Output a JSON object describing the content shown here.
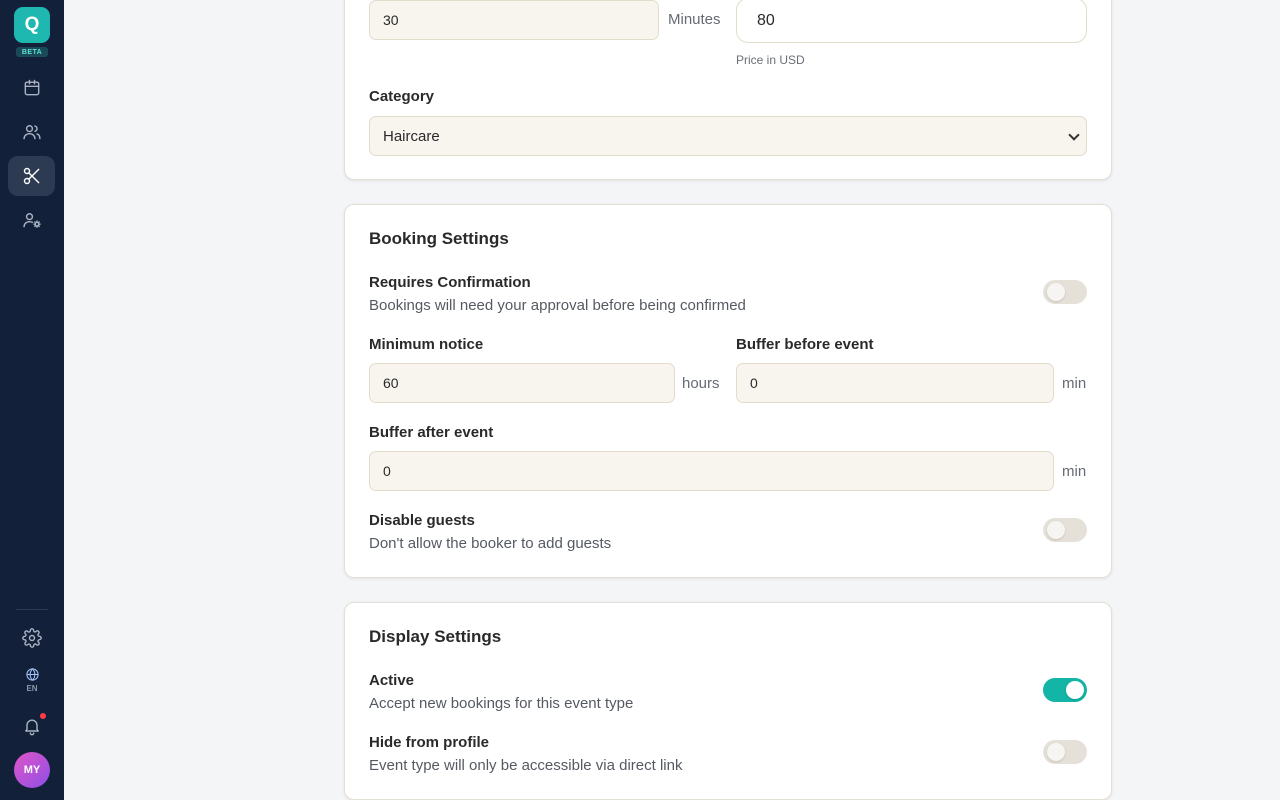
{
  "sidebar": {
    "logo_letter": "Q",
    "beta_label": "BETA",
    "nav": [
      {
        "icon": "calendar-icon",
        "active": false
      },
      {
        "icon": "users-icon",
        "active": false
      },
      {
        "icon": "scissors-icon",
        "active": true
      },
      {
        "icon": "user-settings-icon",
        "active": false
      }
    ],
    "language_code": "EN",
    "avatar_initials": "MY",
    "notification_dot": true
  },
  "details_card": {
    "duration_value": "30",
    "duration_unit": "Minutes",
    "price_value": "80",
    "price_helper": "Price in USD",
    "category_label": "Category",
    "category_value": "Haircare"
  },
  "booking_settings": {
    "title": "Booking Settings",
    "requires_confirmation": {
      "label": "Requires Confirmation",
      "description": "Bookings will need your approval before being confirmed",
      "enabled": false
    },
    "minimum_notice": {
      "label": "Minimum notice",
      "value": "60",
      "unit": "hours"
    },
    "buffer_before": {
      "label": "Buffer before event",
      "value": "0",
      "unit": "min"
    },
    "buffer_after": {
      "label": "Buffer after event",
      "value": "0",
      "unit": "min"
    },
    "disable_guests": {
      "label": "Disable guests",
      "description": "Don't allow the booker to add guests",
      "enabled": false
    }
  },
  "display_settings": {
    "title": "Display Settings",
    "active": {
      "label": "Active",
      "description": "Accept new bookings for this event type",
      "enabled": true
    },
    "hide_from_profile": {
      "label": "Hide from profile",
      "description": "Event type will only be accessible via direct link",
      "enabled": false
    }
  },
  "colors": {
    "sidebar_bg": "#13203a",
    "accent": "#13b5a6",
    "input_bg": "#f8f5ef"
  }
}
